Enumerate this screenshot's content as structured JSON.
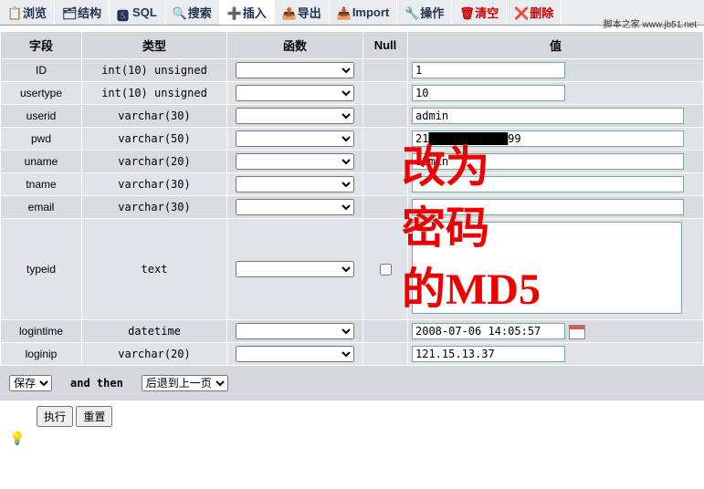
{
  "tabs": [
    {
      "label": "浏览",
      "icon": "browse"
    },
    {
      "label": "结构",
      "icon": "structure"
    },
    {
      "label": "SQL",
      "icon": "sql"
    },
    {
      "label": "搜索",
      "icon": "search"
    },
    {
      "label": "插入",
      "icon": "insert",
      "active": true
    },
    {
      "label": "导出",
      "icon": "export"
    },
    {
      "label": "Import",
      "icon": "import"
    },
    {
      "label": "操作",
      "icon": "operations"
    },
    {
      "label": "清空",
      "icon": "empty"
    },
    {
      "label": "删除",
      "icon": "drop"
    }
  ],
  "watermark": "脚本之家 www.jb51.net",
  "headers": {
    "field": "字段",
    "type": "类型",
    "function": "函数",
    "null": "Null",
    "value": "值"
  },
  "rows": [
    {
      "field": "ID",
      "type": "int(10) unsigned",
      "value": "1",
      "short": true
    },
    {
      "field": "usertype",
      "type": "int(10) unsigned",
      "value": "10",
      "short": true
    },
    {
      "field": "userid",
      "type": "varchar(30)",
      "value": "admin"
    },
    {
      "field": "pwd",
      "type": "varchar(50)",
      "value": "21████████████99"
    },
    {
      "field": "uname",
      "type": "varchar(20)",
      "value": "admin"
    },
    {
      "field": "tname",
      "type": "varchar(30)",
      "value": ""
    },
    {
      "field": "email",
      "type": "varchar(30)",
      "value": ""
    },
    {
      "field": "typeid",
      "type": "text",
      "value": "",
      "textarea": true,
      "nullcheck": true
    },
    {
      "field": "logintime",
      "type": "datetime",
      "value": "2008-07-06 14:05:57",
      "short": true,
      "calendar": true
    },
    {
      "field": "loginip",
      "type": "varchar(20)",
      "value": "121.15.13.37",
      "short": true
    }
  ],
  "footer": {
    "save": "保存",
    "and_then": "and then",
    "go_back": "后退到上一页",
    "execute": "执行",
    "reset": "重置"
  },
  "handwriting": "改为密码的MD5"
}
